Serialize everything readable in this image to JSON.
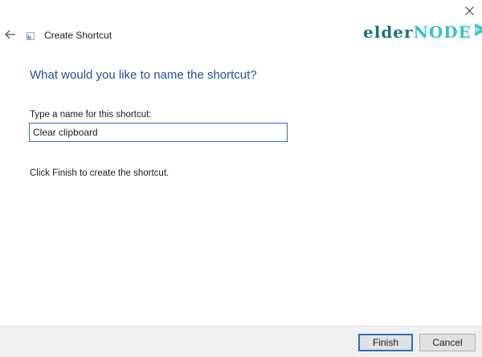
{
  "window": {
    "title": "Create Shortcut"
  },
  "logo": {
    "part1": "elder",
    "part2": "NODE"
  },
  "content": {
    "heading": "What would you like to name the shortcut?",
    "field_label": "Type a name for this shortcut:",
    "name_value": "Clear clipboard",
    "hint": "Click Finish to create the shortcut."
  },
  "footer": {
    "finish_label": "Finish",
    "cancel_label": "Cancel"
  },
  "icons": {
    "close": "close-icon",
    "back": "back-arrow-icon",
    "shortcut": "shortcut-icon",
    "logo_play": "play-icon"
  },
  "colors": {
    "heading": "#1e4e9e",
    "focus_border": "#2c6fbf",
    "logo_dark": "#1d6f8a",
    "logo_light": "#35c2c6"
  }
}
